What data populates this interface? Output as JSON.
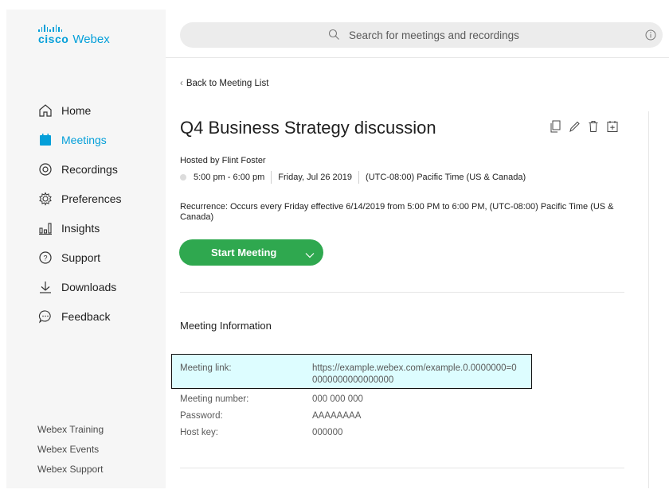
{
  "logo": {
    "company": "cisco",
    "product": "Webex"
  },
  "nav": {
    "items": [
      {
        "label": "Home",
        "icon": "home-icon"
      },
      {
        "label": "Meetings",
        "icon": "calendar-icon",
        "active": true
      },
      {
        "label": "Recordings",
        "icon": "record-icon"
      },
      {
        "label": "Preferences",
        "icon": "gear-icon"
      },
      {
        "label": "Insights",
        "icon": "chart-icon"
      },
      {
        "label": "Support",
        "icon": "help-icon"
      },
      {
        "label": "Downloads",
        "icon": "download-icon"
      },
      {
        "label": "Feedback",
        "icon": "chat-icon"
      }
    ]
  },
  "footer_links": [
    "Webex Training",
    "Webex Events",
    "Webex Support"
  ],
  "search": {
    "placeholder": "Search for meetings and recordings"
  },
  "back_label": "Back to Meeting List",
  "meeting": {
    "title": "Q4 Business Strategy discussion",
    "host": "Hosted by Flint Foster",
    "time": "5:00 pm - 6:00 pm",
    "date": "Friday, Jul 26 2019",
    "timezone": "(UTC-08:00) Pacific Time (US & Canada)",
    "recurrence": "Recurrence: Occurs every Friday effective 6/14/2019 from 5:00 PM to 6:00 PM, (UTC-08:00) Pacific Time (US & Canada)",
    "start_label": "Start Meeting"
  },
  "info": {
    "section_title": "Meeting Information",
    "link_label": "Meeting link:",
    "link_value": "https://example.webex.com/example.0.0000000=00000000000000000",
    "number_label": "Meeting number:",
    "number_value": "000 000 000",
    "password_label": "Password:",
    "password_value": "AAAAAAAA",
    "hostkey_label": "Host key:",
    "hostkey_value": "000000"
  },
  "colors": {
    "accent": "#049fd9",
    "start_button": "#2fa84f",
    "highlight": "#ddfdff"
  }
}
